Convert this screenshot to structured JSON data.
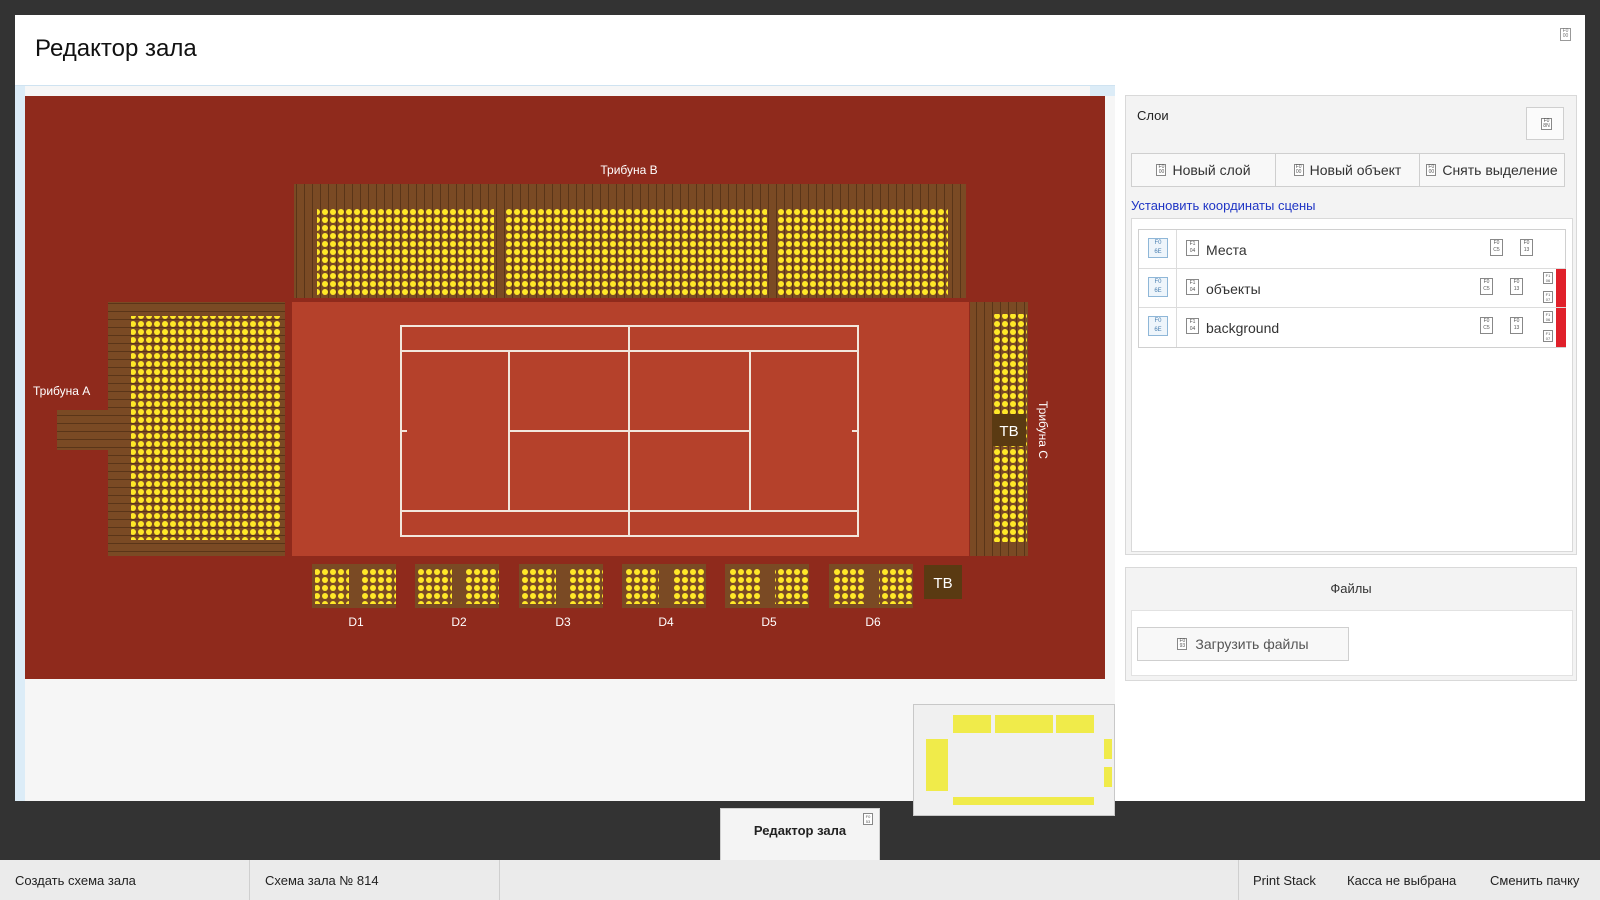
{
  "window": {
    "title": "Редактор зала",
    "close_icon": "close-icon"
  },
  "scene": {
    "labels": {
      "stand_a": "Трибуна А",
      "stand_b": "Трибуна В",
      "stand_c": "Трибуна С",
      "tv_right": "ТВ",
      "tv_bottom": "ТВ"
    },
    "boxes": [
      "D1",
      "D2",
      "D3",
      "D4",
      "D5",
      "D6"
    ],
    "colors": {
      "background": "#8f2a1c",
      "court": "#b5412b",
      "seat": "#ffe828",
      "stand": "#7a4a24",
      "line": "#f2e7dc"
    }
  },
  "layers_panel": {
    "title": "Слои",
    "settings_icon": "settings-icon",
    "buttons": {
      "new_layer": "Новый слой",
      "new_object": "Новый объект",
      "deselect": "Снять выделение"
    },
    "set_coords_link": "Установить координаты сцены",
    "layers": [
      {
        "name": "Места",
        "marked": false
      },
      {
        "name": "объекты",
        "marked": true
      },
      {
        "name": "background",
        "marked": true
      }
    ]
  },
  "files_panel": {
    "title": "Файлы",
    "upload_label": "Загрузить файлы"
  },
  "window_tab": {
    "label": "Редактор зала"
  },
  "taskbar": {
    "create_scheme": "Создать схема зала",
    "scheme": "Схема зала № 814",
    "print_stack": "Print Stack",
    "cashbox": "Касса не выбрана",
    "change_batch": "Сменить пачку"
  }
}
